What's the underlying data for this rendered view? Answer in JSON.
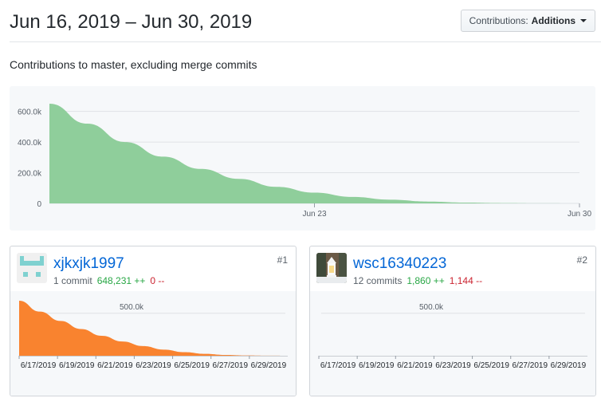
{
  "header": {
    "date_range": "Jun 16, 2019 – Jun 30, 2019",
    "dropdown_label": "Contributions:",
    "dropdown_value": "Additions"
  },
  "subtitle": "Contributions to master, excluding merge commits",
  "colors": {
    "main_area": "#8fce9b",
    "user1_area": "#f9832f",
    "grid": "#dfe2e5",
    "link": "#0366d6",
    "additions": "#28a745",
    "deletions": "#cb2431"
  },
  "chart_data": [
    {
      "type": "area",
      "x": [
        "2019-06-16",
        "2019-06-17",
        "2019-06-18",
        "2019-06-19",
        "2019-06-20",
        "2019-06-21",
        "2019-06-22",
        "2019-06-23",
        "2019-06-24",
        "2019-06-25",
        "2019-06-26",
        "2019-06-27",
        "2019-06-28",
        "2019-06-29",
        "2019-06-30"
      ],
      "values": [
        650093,
        520000,
        400000,
        305000,
        225000,
        160000,
        108000,
        70000,
        42000,
        24000,
        12000,
        5500,
        2200,
        700,
        0
      ],
      "ylim": [
        0,
        650093
      ],
      "yticks": [
        0,
        200000,
        400000,
        600000
      ],
      "ytick_labels": [
        "0",
        "200.0k",
        "400.0k",
        "600.0k"
      ],
      "xtick_labels": [
        "Jun 23",
        "Jun 30"
      ],
      "grid": true
    },
    {
      "type": "area",
      "x": [
        "6/17/2019",
        "6/18/2019",
        "6/19/2019",
        "6/20/2019",
        "6/21/2019",
        "6/22/2019",
        "6/23/2019",
        "6/24/2019",
        "6/25/2019",
        "6/26/2019",
        "6/27/2019",
        "6/28/2019",
        "6/29/2019",
        "6/30/2019"
      ],
      "values": [
        648231,
        520000,
        410000,
        315000,
        235000,
        168000,
        114000,
        72000,
        42000,
        22000,
        9000,
        3000,
        800,
        0
      ],
      "ylim": [
        0,
        648231
      ],
      "ytick_labels": [
        "500.0k"
      ],
      "xtick_labels": [
        "6/17/2019",
        "6/19/2019",
        "6/21/2019",
        "6/23/2019",
        "6/25/2019",
        "6/27/2019",
        "6/29/2019"
      ],
      "grid": true
    },
    {
      "type": "area",
      "x": [
        "6/17/2019",
        "6/18/2019",
        "6/19/2019",
        "6/20/2019",
        "6/21/2019",
        "6/22/2019",
        "6/23/2019",
        "6/24/2019",
        "6/25/2019",
        "6/26/2019",
        "6/27/2019",
        "6/28/2019",
        "6/29/2019",
        "6/30/2019"
      ],
      "values": [
        0,
        0,
        0,
        300,
        0,
        400,
        0,
        500,
        0,
        360,
        0,
        300,
        0,
        0
      ],
      "ylim": [
        0,
        648231
      ],
      "ytick_labels": [
        "500.0k"
      ],
      "xtick_labels": [
        "6/17/2019",
        "6/19/2019",
        "6/21/2019",
        "6/23/2019",
        "6/25/2019",
        "6/27/2019",
        "6/29/2019"
      ],
      "grid": true
    }
  ],
  "contributors": [
    {
      "username": "xjkxjk1997",
      "rank": "#1",
      "commits": "1 commit",
      "additions": "648,231 ++",
      "deletions": "0 --",
      "avatar": "identicon-icon"
    },
    {
      "username": "wsc16340223",
      "rank": "#2",
      "commits": "12 commits",
      "additions": "1,860 ++",
      "deletions": "1,144 --",
      "avatar": "lantern-photo-icon"
    }
  ]
}
